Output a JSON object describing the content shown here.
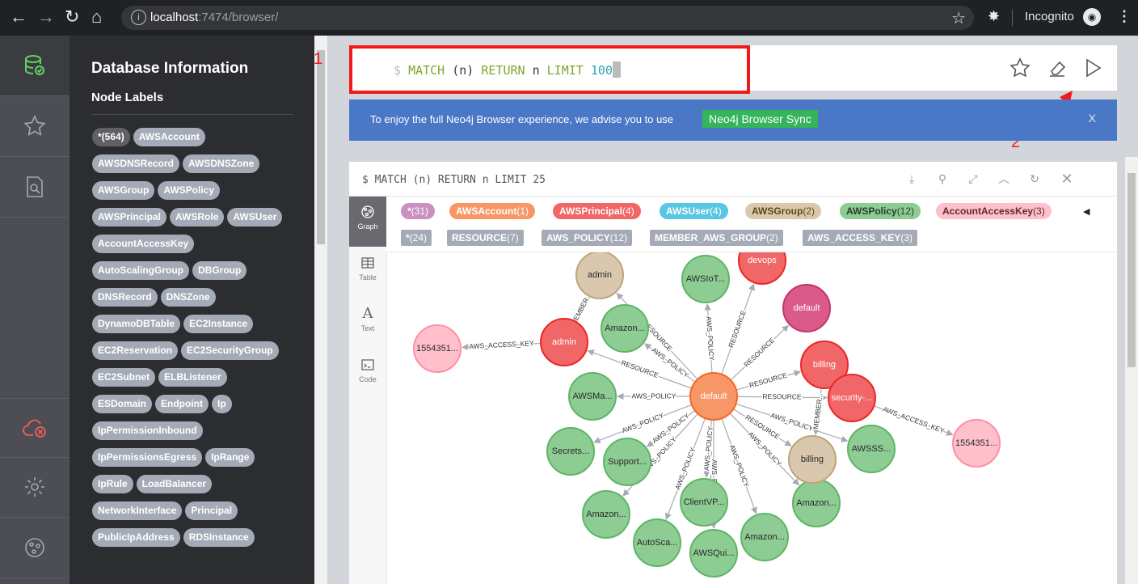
{
  "browser": {
    "url_host": "localhost",
    "url_port_path": ":7474/browser/",
    "incognito_label": "Incognito"
  },
  "sidebar": {
    "title": "Database Information",
    "subtitle": "Node Labels",
    "labels": [
      "*(564)",
      "AWSAccount",
      "AWSDNSRecord",
      "AWSDNSZone",
      "AWSGroup",
      "AWSPolicy",
      "AWSPrincipal",
      "AWSRole",
      "AWSUser",
      "AccountAccessKey",
      "AutoScalingGroup",
      "DBGroup",
      "DNSRecord",
      "DNSZone",
      "DynamoDBTable",
      "EC2Instance",
      "EC2Reservation",
      "EC2SecurityGroup",
      "EC2Subnet",
      "ELBListener",
      "ESDomain",
      "Endpoint",
      "Ip",
      "IpPermissionInbound",
      "IpPermissionsEgress",
      "IpRange",
      "IpRule",
      "LoadBalancer",
      "NetworkInterface",
      "Principal",
      "PublicIpAddress",
      "RDSInstance"
    ]
  },
  "editor": {
    "prompt": "$",
    "tokens": [
      {
        "t": "MATCH",
        "c": "kw"
      },
      {
        "t": " (n) ",
        "c": ""
      },
      {
        "t": "RETURN",
        "c": "kw"
      },
      {
        "t": " n ",
        "c": ""
      },
      {
        "t": "LIMIT",
        "c": "kw"
      },
      {
        "t": " 100",
        "c": "num"
      }
    ]
  },
  "annotations": {
    "first": "1",
    "second": "2"
  },
  "banner": {
    "text": "To enjoy the full Neo4j Browser experience, we advise you to use",
    "button": "Neo4j Browser Sync",
    "close": "X"
  },
  "frame": {
    "title": "$ MATCH (n) RETURN n LIMIT 25",
    "views": [
      {
        "label": "Graph",
        "icon": "graph-icon"
      },
      {
        "label": "Table",
        "icon": "table-icon"
      },
      {
        "label": "Text",
        "icon": "text-icon"
      },
      {
        "label": "Code",
        "icon": "code-icon"
      }
    ],
    "node_legend": [
      {
        "name": "*",
        "count": "(31)",
        "bg": "#c990c0",
        "fg": "#ffffff"
      },
      {
        "name": "AWSAccount",
        "count": "(1)",
        "bg": "#f79767",
        "fg": "#ffffff"
      },
      {
        "name": "AWSPrincipal",
        "count": "(4)",
        "bg": "#f16667",
        "fg": "#ffffff"
      },
      {
        "name": "AWSUser",
        "count": "(4)",
        "bg": "#57c7e3",
        "fg": "#ffffff"
      },
      {
        "name": "AWSGroup",
        "count": "(2)",
        "bg": "#d9c8ae",
        "fg": "#604a0e"
      },
      {
        "name": "AWSPolicy",
        "count": "(12)",
        "bg": "#8dcc93",
        "fg": "#2a3b2b"
      },
      {
        "name": "AccountAccessKey",
        "count": "(3)",
        "bg": "#ffc0cb",
        "fg": "#5a2a33"
      }
    ],
    "rel_legend": [
      {
        "name": "*",
        "count": "(24)"
      },
      {
        "name": "RESOURCE",
        "count": "(7)"
      },
      {
        "name": "AWS_POLICY",
        "count": "(12)"
      },
      {
        "name": "MEMBER_AWS_GROUP",
        "count": "(2)"
      },
      {
        "name": "AWS_ACCESS_KEY",
        "count": "(3)"
      }
    ]
  },
  "graph": {
    "nodes": [
      {
        "id": "center",
        "label": "default",
        "color": "#f79767",
        "stroke": "#f36924"
      },
      {
        "id": "admin_g",
        "label": "admin",
        "color": "#d9c8ae",
        "stroke": "#c0a378"
      },
      {
        "id": "iot",
        "label": "AWSIoT...",
        "color": "#8dcc93",
        "stroke": "#5db665"
      },
      {
        "id": "devops",
        "label": "devops",
        "color": "#f16667",
        "stroke": "#eb2728"
      },
      {
        "id": "default2",
        "label": "default",
        "color": "#da5a8a",
        "stroke": "#c2366c"
      },
      {
        "id": "billing_p",
        "label": "billing",
        "color": "#f16667",
        "stroke": "#eb2728"
      },
      {
        "id": "security",
        "label": "security-...",
        "color": "#f16667",
        "stroke": "#eb2728"
      },
      {
        "id": "key2",
        "label": "1554351...",
        "color": "#ffc0cb",
        "stroke": "#ff8fa3"
      },
      {
        "id": "amazon1",
        "label": "Amazon...",
        "color": "#8dcc93",
        "stroke": "#5db665"
      },
      {
        "id": "admin_p",
        "label": "admin",
        "color": "#f16667",
        "stroke": "#eb2728"
      },
      {
        "id": "key1",
        "label": "1554351...",
        "color": "#ffc0cb",
        "stroke": "#ff8fa3"
      },
      {
        "id": "awsma",
        "label": "AWSMa...",
        "color": "#8dcc93",
        "stroke": "#5db665"
      },
      {
        "id": "secrets",
        "label": "Secrets...",
        "color": "#8dcc93",
        "stroke": "#5db665"
      },
      {
        "id": "support",
        "label": "Support...",
        "color": "#8dcc93",
        "stroke": "#5db665"
      },
      {
        "id": "amazon2",
        "label": "Amazon...",
        "color": "#8dcc93",
        "stroke": "#5db665"
      },
      {
        "id": "autosca",
        "label": "AutoSca...",
        "color": "#8dcc93",
        "stroke": "#5db665"
      },
      {
        "id": "clientvp",
        "label": "ClientVP...",
        "color": "#8dcc93",
        "stroke": "#5db665"
      },
      {
        "id": "awsqui",
        "label": "AWSQui...",
        "color": "#8dcc93",
        "stroke": "#5db665"
      },
      {
        "id": "amazon3",
        "label": "Amazon...",
        "color": "#8dcc93",
        "stroke": "#5db665"
      },
      {
        "id": "amazon4",
        "label": "Amazon...",
        "color": "#8dcc93",
        "stroke": "#5db665"
      },
      {
        "id": "billing_g",
        "label": "billing",
        "color": "#d9c8ae",
        "stroke": "#c0a378"
      },
      {
        "id": "awsss",
        "label": "AWSSS...",
        "color": "#8dcc93",
        "stroke": "#5db665"
      }
    ],
    "edges": [
      {
        "from": "admin_p",
        "to": "key1",
        "label": "AWS_ACCESS_KEY"
      },
      {
        "from": "security",
        "to": "key2",
        "label": "AWS_ACCESS_KEY"
      },
      {
        "from": "admin_p",
        "to": "admin_g",
        "label": "MEMBER..."
      },
      {
        "from": "center",
        "to": "admin_p",
        "label": "RESOURCE"
      },
      {
        "from": "center",
        "to": "amazon1",
        "label": "AWS_POLICY"
      },
      {
        "from": "center",
        "to": "admin_g",
        "label": "RESOURCE"
      },
      {
        "from": "center",
        "to": "iot",
        "label": "AWS_POLICY"
      },
      {
        "from": "center",
        "to": "devops",
        "label": "RESOURCE"
      },
      {
        "from": "center",
        "to": "default2",
        "label": "RESOURCE"
      },
      {
        "from": "center",
        "to": "billing_p",
        "label": "RESOURCE"
      },
      {
        "from": "center",
        "to": "security",
        "label": "RESOURCE"
      },
      {
        "from": "center",
        "to": "awsma",
        "label": "AWS_POLICY"
      },
      {
        "from": "center",
        "to": "secrets",
        "label": "AWS_POLICY"
      },
      {
        "from": "center",
        "to": "support",
        "label": "AWS_POLICY"
      },
      {
        "from": "center",
        "to": "amazon2",
        "label": "AWS_POLICY"
      },
      {
        "from": "center",
        "to": "autosca",
        "label": "AWS_POLICY"
      },
      {
        "from": "center",
        "to": "clientvp",
        "label": "AWS_POLICY"
      },
      {
        "from": "center",
        "to": "awsqui",
        "label": "AWS_PO"
      },
      {
        "from": "center",
        "to": "amazon3",
        "label": "AWS_POLICY"
      },
      {
        "from": "center",
        "to": "amazon4",
        "label": "AWS_POLICY"
      },
      {
        "from": "center",
        "to": "billing_g",
        "label": "RESOURCE"
      },
      {
        "from": "center",
        "to": "awsss",
        "label": "AWS_POLICY"
      },
      {
        "from": "billing_p",
        "to": "billing_g",
        "label": "MEMBER..."
      }
    ]
  }
}
